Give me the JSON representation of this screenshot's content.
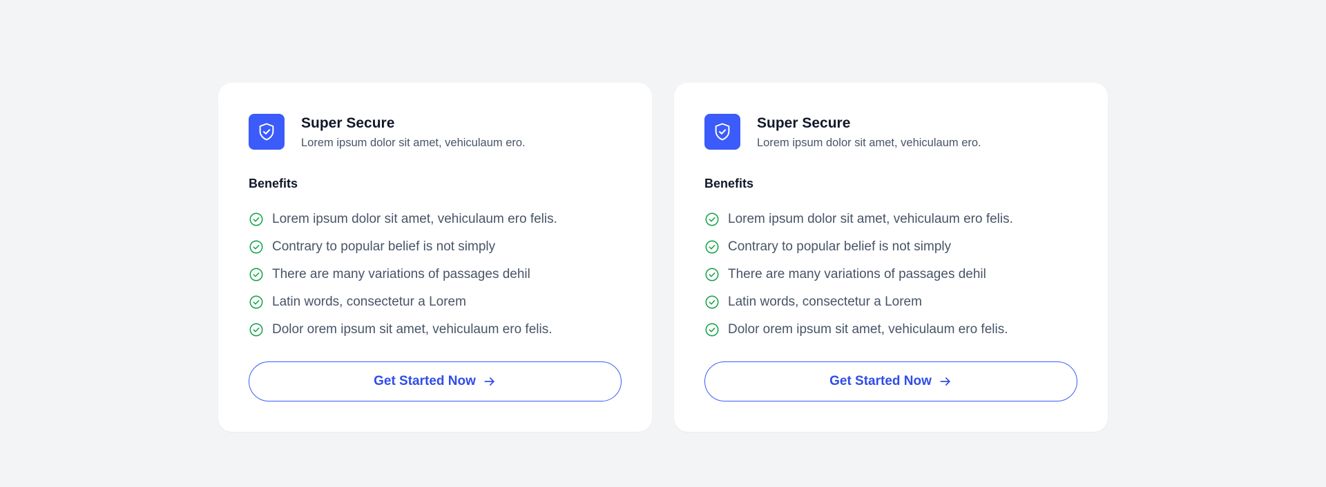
{
  "colors": {
    "background": "#f3f4f6",
    "card": "#ffffff",
    "accent": "#3b5bfa",
    "check": "#16a34a",
    "title": "#101828",
    "body_text": "#475467"
  },
  "cards": [
    {
      "icon": "shield-check-icon",
      "title": "Super Secure",
      "subtitle": "Lorem ipsum dolor sit amet, vehiculaum ero.",
      "benefits_heading": "Benefits",
      "benefits": [
        "Lorem ipsum dolor sit amet, vehiculaum ero felis.",
        "Contrary to popular belief is not simply",
        "There are many variations of passages dehil",
        "Latin words, consectetur a Lorem",
        "Dolor orem ipsum sit amet, vehiculaum ero felis."
      ],
      "cta_label": "Get Started Now",
      "cta_icon": "arrow-right-icon"
    },
    {
      "icon": "shield-check-icon",
      "title": "Super Secure",
      "subtitle": "Lorem ipsum dolor sit amet, vehiculaum ero.",
      "benefits_heading": "Benefits",
      "benefits": [
        "Lorem ipsum dolor sit amet, vehiculaum ero felis.",
        "Contrary to popular belief is not simply",
        "There are many variations of passages dehil",
        "Latin words, consectetur a Lorem",
        "Dolor orem ipsum sit amet, vehiculaum ero felis."
      ],
      "cta_label": "Get Started Now",
      "cta_icon": "arrow-right-icon"
    }
  ]
}
